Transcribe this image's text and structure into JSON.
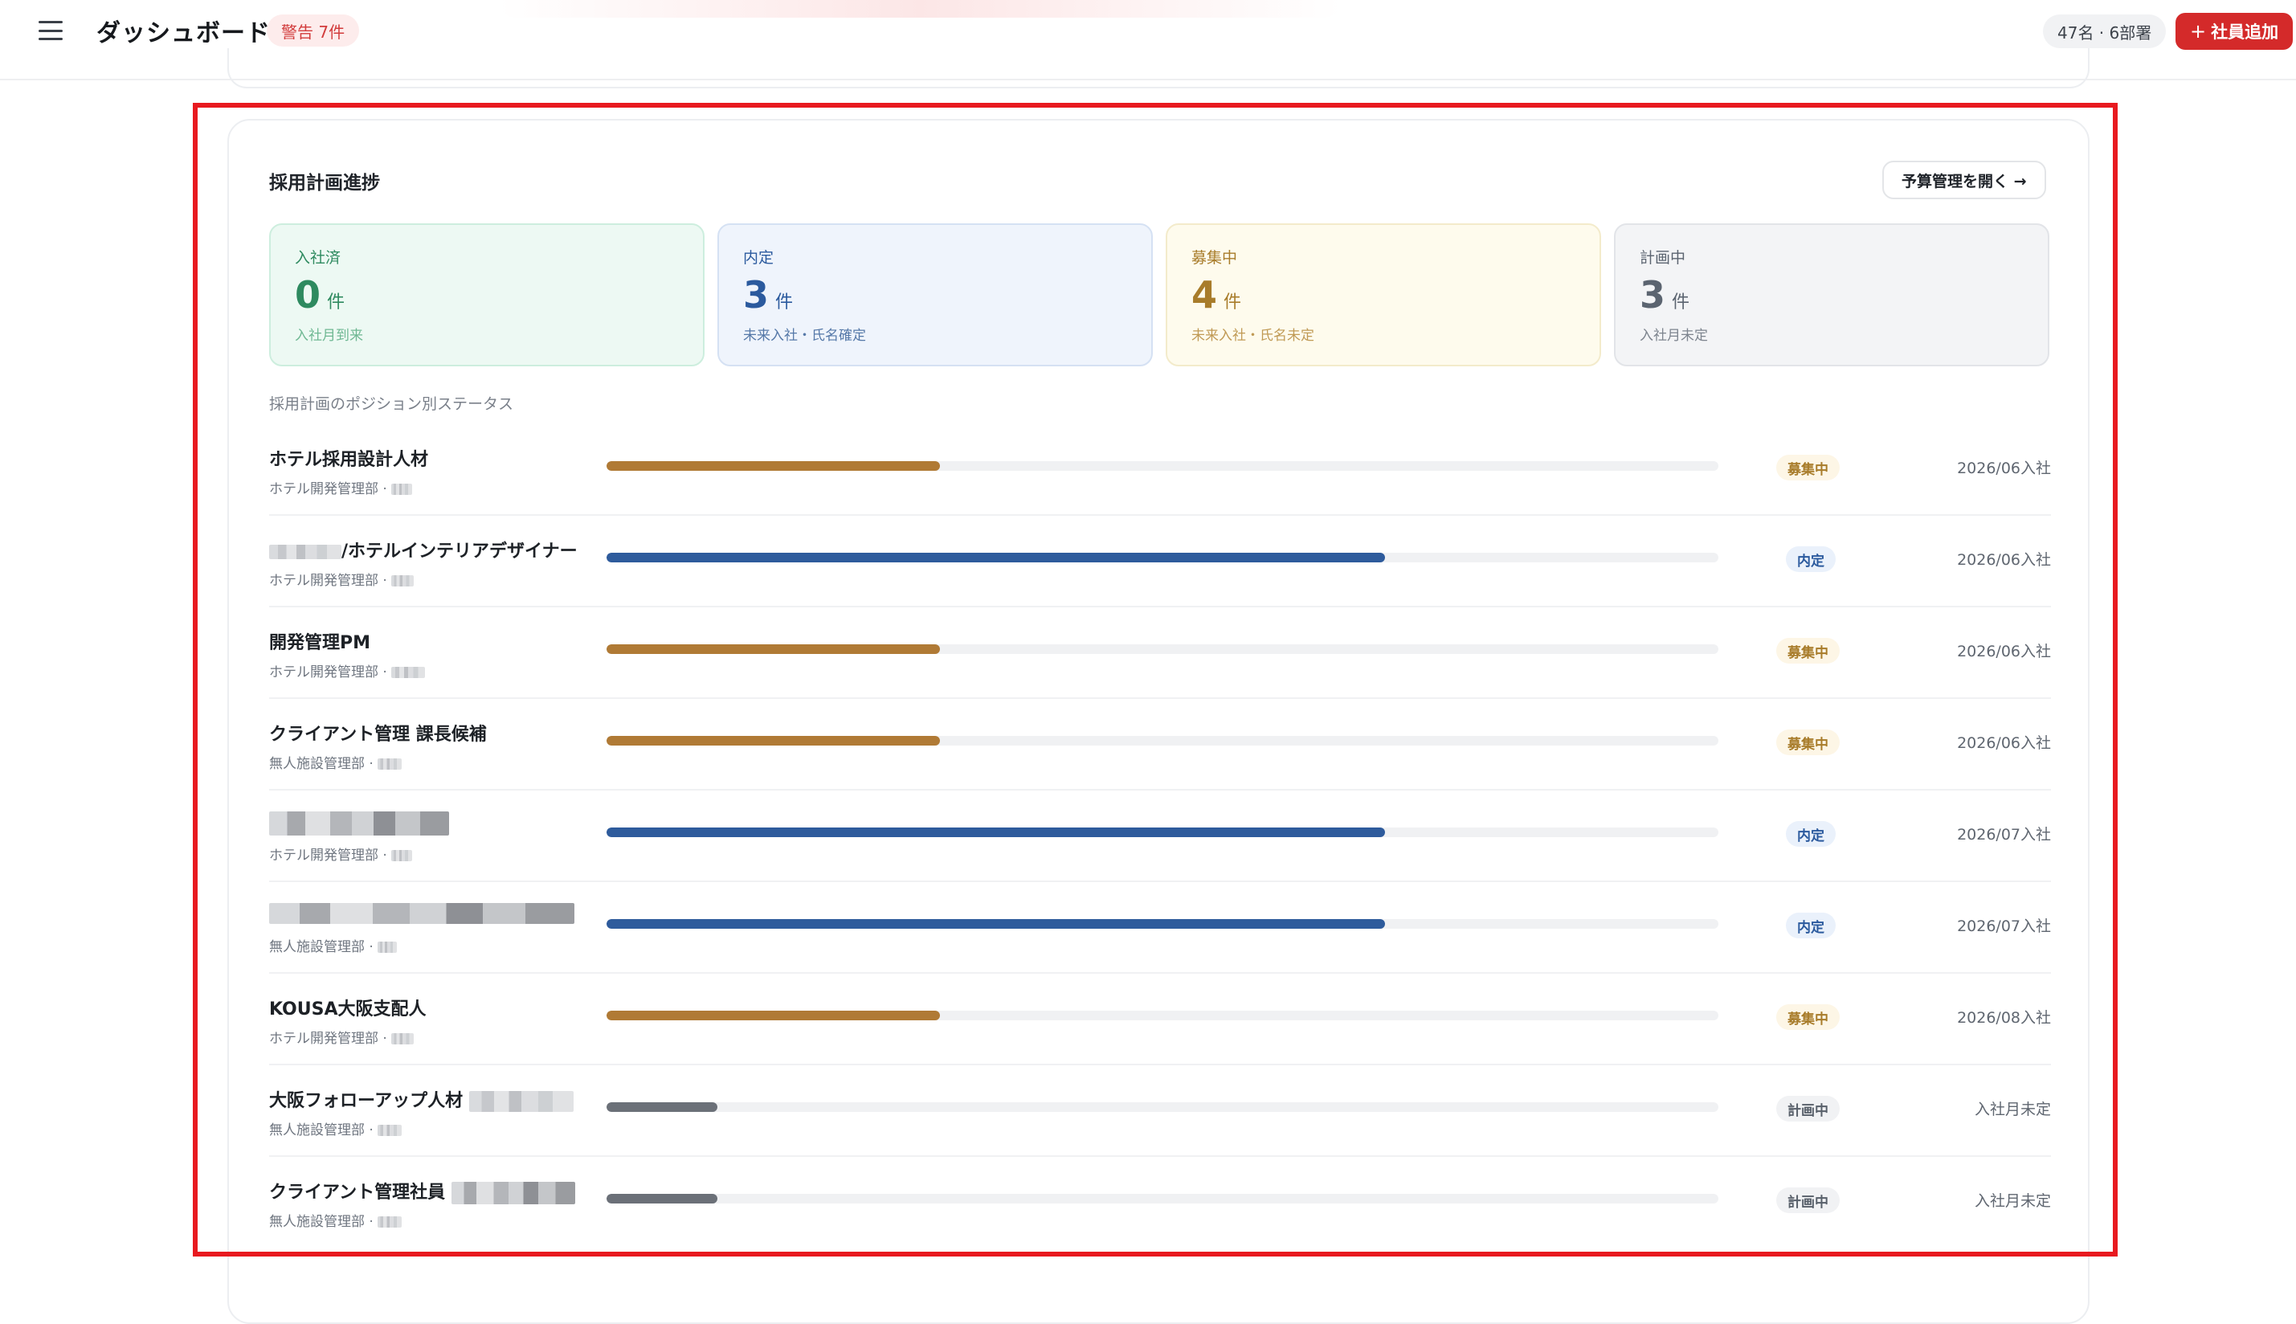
{
  "header": {
    "title": "ダッシュボード",
    "warning_badge": "警告 7件",
    "headcount": "47名 · 6部署",
    "add_button": "社員追加",
    "add_icon": "plus-icon"
  },
  "card": {
    "title": "採用計画進捗",
    "budget_button": "予算管理を開く →",
    "stats": [
      {
        "label": "入社済",
        "value": "0",
        "unit": "件",
        "sub": "入社月到来",
        "color": "#2e8a5f"
      },
      {
        "label": "内定",
        "value": "3",
        "unit": "件",
        "sub": "未来入社・氏名確定",
        "color": "#2b5a9e"
      },
      {
        "label": "募集中",
        "value": "4",
        "unit": "件",
        "sub": "未来入社・氏名未定",
        "color": "#a87c2a"
      },
      {
        "label": "計画中",
        "value": "3",
        "unit": "件",
        "sub": "入社月未定",
        "color": "#5b6470"
      }
    ],
    "section_label": "採用計画のポジション別ステータス",
    "positions": [
      {
        "name": "ホテル採用設計人材",
        "dept": "ホテル開発管理部 ·",
        "progress": 0.3,
        "status": "募集中",
        "date": "2026/06入社"
      },
      {
        "name": "/ホテルインテリアデザイナー",
        "dept": "ホテル開発管理部 ·",
        "progress": 0.7,
        "status": "内定",
        "date": "2026/06入社"
      },
      {
        "name": "開発管理PM",
        "dept": "ホテル開発管理部 ·",
        "progress": 0.3,
        "status": "募集中",
        "date": "2026/06入社"
      },
      {
        "name": "クライアント管理 課長候補",
        "dept": "無人施設管理部 ·",
        "progress": 0.3,
        "status": "募集中",
        "date": "2026/06入社"
      },
      {
        "name": "",
        "dept": "ホテル開発管理部 ·",
        "progress": 0.7,
        "status": "内定",
        "date": "2026/07入社"
      },
      {
        "name": "",
        "dept": "無人施設管理部 ·",
        "progress": 0.7,
        "status": "内定",
        "date": "2026/07入社"
      },
      {
        "name": "KOUSA大阪支配人",
        "dept": "ホテル開発管理部 ·",
        "progress": 0.3,
        "status": "募集中",
        "date": "2026/08入社"
      },
      {
        "name": "大阪フォローアップ人材",
        "dept": "無人施設管理部 ·",
        "progress": 0.1,
        "status": "計画中",
        "date": "入社月未定"
      },
      {
        "name": "クライアント管理社員",
        "dept": "無人施設管理部 ·",
        "progress": 0.1,
        "status": "計画中",
        "date": "入社月未定"
      }
    ]
  },
  "colors": {
    "accent": "#d42a2a",
    "recruit": "#b07a35",
    "offer": "#2e5b9c",
    "plan": "#6b7078",
    "highlight": "#e8191f"
  }
}
